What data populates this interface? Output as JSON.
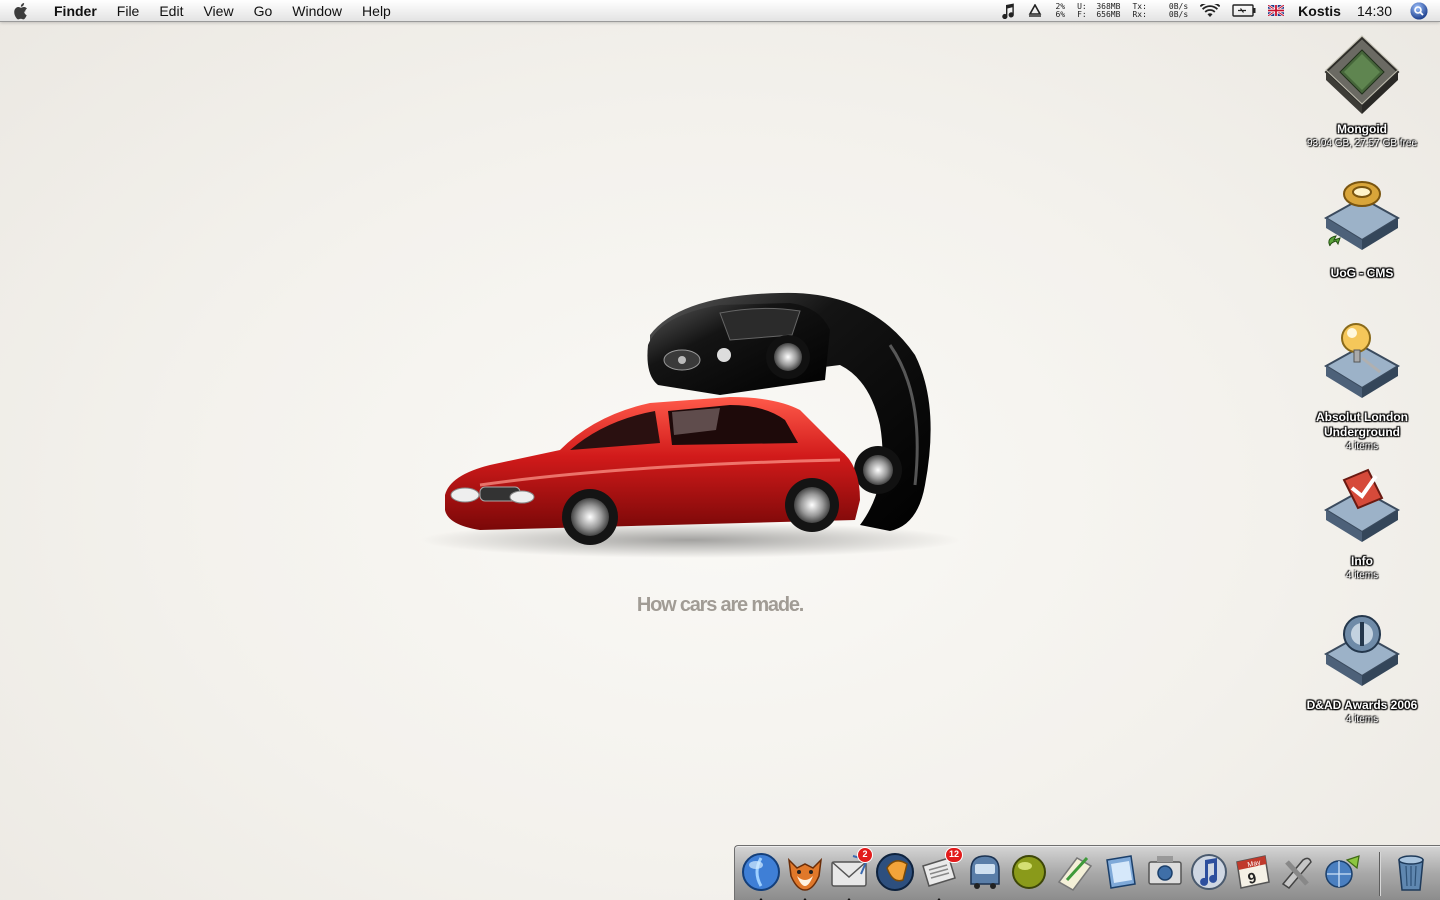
{
  "menubar": {
    "app_name": "Finder",
    "items": [
      {
        "label": "File"
      },
      {
        "label": "Edit"
      },
      {
        "label": "View"
      },
      {
        "label": "Go"
      },
      {
        "label": "Window"
      },
      {
        "label": "Help"
      }
    ],
    "cpu": {
      "line1": "2%",
      "line2": "6%"
    },
    "memory": {
      "line1": "U:  368MB",
      "line2": "F:  656MB"
    },
    "network_labels": {
      "line1": "Tx:",
      "line2": "Rx:"
    },
    "network_rates": {
      "line1": "0B/s",
      "line2": "0B/s"
    },
    "user": "Kostis",
    "time": "14:30",
    "icons": [
      "itunes-note-icon",
      "recycle-icon",
      "wifi-icon",
      "battery-icon",
      "uk-flag-icon",
      "spotlight-icon"
    ]
  },
  "wallpaper": {
    "tagline": "How cars are made.",
    "colors": {
      "red_car": "#d11a1a",
      "black_car": "#141414"
    }
  },
  "desktop_icons": [
    {
      "label": "Mongoid",
      "subtitle": "93.04 GB, 27.57 GB free",
      "icon": "hard-drive-icon"
    },
    {
      "label": "UoG - CMS",
      "subtitle": "",
      "icon": "network-volume-icon"
    },
    {
      "label": "Absolut London Underground",
      "subtitle": "4 items",
      "icon": "folder-lamp-icon"
    },
    {
      "label": "Info",
      "subtitle": "4 items",
      "icon": "folder-info-icon"
    },
    {
      "label": "D&AD Awards 2006",
      "subtitle": "4 items",
      "icon": "folder-award-icon"
    }
  ],
  "dock": {
    "items": [
      {
        "name": "finder-icon",
        "running": true,
        "badge": ""
      },
      {
        "name": "firefox-icon",
        "running": true,
        "badge": ""
      },
      {
        "name": "mail-icon",
        "running": true,
        "badge": "2"
      },
      {
        "name": "ichat-icon",
        "running": false,
        "badge": ""
      },
      {
        "name": "newsfire-icon",
        "running": true,
        "badge": "12"
      },
      {
        "name": "transmit-icon",
        "running": false,
        "badge": ""
      },
      {
        "name": "camino-icon",
        "running": false,
        "badge": ""
      },
      {
        "name": "textedit-icon",
        "running": false,
        "badge": ""
      },
      {
        "name": "preview-icon",
        "running": false,
        "badge": ""
      },
      {
        "name": "photos-icon",
        "running": false,
        "badge": ""
      },
      {
        "name": "itunes-icon",
        "running": false,
        "badge": ""
      },
      {
        "name": "ical-icon",
        "running": false,
        "badge": ""
      },
      {
        "name": "utilities-icon",
        "running": false,
        "badge": ""
      },
      {
        "name": "network-icon",
        "running": false,
        "badge": ""
      },
      {
        "name": "trash-icon",
        "running": false,
        "badge": ""
      }
    ],
    "ical_month": "May",
    "ical_day": "9"
  }
}
